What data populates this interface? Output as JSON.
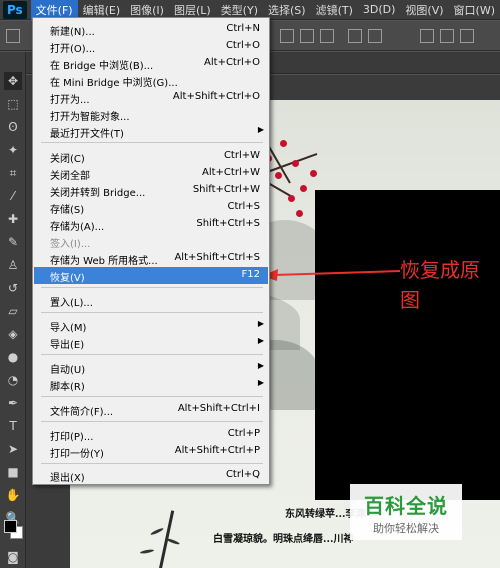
{
  "app": {
    "logo": "Ps"
  },
  "menubar": [
    {
      "label": "文件(F)",
      "active": true
    },
    {
      "label": "编辑(E)"
    },
    {
      "label": "图像(I)"
    },
    {
      "label": "图层(L)"
    },
    {
      "label": "类型(Y)"
    },
    {
      "label": "选择(S)"
    },
    {
      "label": "滤镜(T)"
    },
    {
      "label": "3D(D)"
    },
    {
      "label": "视图(V)"
    },
    {
      "label": "窗口(W)"
    }
  ],
  "file_menu": [
    {
      "label": "新建(N)...",
      "shortcut": "Ctrl+N"
    },
    {
      "label": "打开(O)...",
      "shortcut": "Ctrl+O"
    },
    {
      "label": "在 Bridge 中浏览(B)...",
      "shortcut": "Alt+Ctrl+O"
    },
    {
      "label": "在 Mini Bridge 中浏览(G)...",
      "shortcut": ""
    },
    {
      "label": "打开为...",
      "shortcut": "Alt+Shift+Ctrl+O"
    },
    {
      "label": "打开为智能对象...",
      "shortcut": ""
    },
    {
      "label": "最近打开文件(T)",
      "shortcut": "",
      "submenu": true
    },
    {
      "label": "关闭(C)",
      "shortcut": "Ctrl+W"
    },
    {
      "label": "关闭全部",
      "shortcut": "Alt+Ctrl+W"
    },
    {
      "label": "关闭并转到 Bridge...",
      "shortcut": "Shift+Ctrl+W"
    },
    {
      "label": "存储(S)",
      "shortcut": "Ctrl+S"
    },
    {
      "label": "存储为(A)...",
      "shortcut": "Shift+Ctrl+S"
    },
    {
      "label": "签入(I)...",
      "shortcut": "",
      "disabled": true
    },
    {
      "label": "存储为 Web 所用格式...",
      "shortcut": "Alt+Shift+Ctrl+S"
    },
    {
      "label": "恢复(V)",
      "shortcut": "F12",
      "highlighted": true
    },
    {
      "label": "置入(L)...",
      "shortcut": ""
    },
    {
      "label": "导入(M)",
      "shortcut": "",
      "submenu": true
    },
    {
      "label": "导出(E)",
      "shortcut": "",
      "submenu": true
    },
    {
      "label": "自动(U)",
      "shortcut": "",
      "submenu": true
    },
    {
      "label": "脚本(R)",
      "shortcut": "",
      "submenu": true
    },
    {
      "label": "文件简介(F)...",
      "shortcut": "Alt+Shift+Ctrl+I"
    },
    {
      "label": "打印(P)...",
      "shortcut": "Ctrl+P"
    },
    {
      "label": "打印一份(Y)",
      "shortcut": "Alt+Shift+Ctrl+P"
    },
    {
      "label": "退出(X)",
      "shortcut": "Ctrl+Q"
    }
  ],
  "annotation": {
    "text": "恢复成原图",
    "color": "#e8302a"
  },
  "canvas": {
    "poem_line1": "东风转绿苹...李津",
    "poem_line2": "白雪凝琼貌。明珠点绛唇...川神"
  },
  "watermark": {
    "title": "百科全说",
    "subtitle": "助你轻松解决"
  },
  "colors": {
    "highlight": "#3b82d9",
    "foreground": "#000000",
    "background": "#ffffff"
  },
  "tools": [
    "move-icon",
    "marquee-icon",
    "lasso-icon",
    "magic-wand-icon",
    "crop-icon",
    "eyedropper-icon",
    "healing-icon",
    "brush-icon",
    "clone-stamp-icon",
    "history-brush-icon",
    "eraser-icon",
    "paint-bucket-icon",
    "blur-icon",
    "dodge-icon",
    "pen-icon",
    "type-icon",
    "path-select-icon",
    "rectangle-icon",
    "hand-icon",
    "zoom-icon"
  ]
}
